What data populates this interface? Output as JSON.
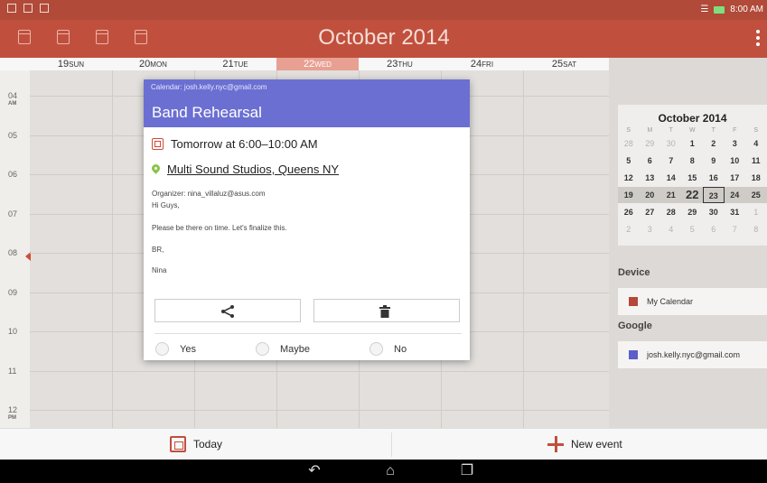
{
  "status_bar": {
    "time": "8:00 AM"
  },
  "app_bar": {
    "title": "October 2014",
    "view_buttons": [
      "day-view-icon",
      "week-view-icon",
      "month-view-icon",
      "agenda-view-icon"
    ]
  },
  "days": [
    {
      "num": "19",
      "name": "SUN"
    },
    {
      "num": "20",
      "name": "MON"
    },
    {
      "num": "21",
      "name": "TUE"
    },
    {
      "num": "22",
      "name": "WED"
    },
    {
      "num": "23",
      "name": "THU"
    },
    {
      "num": "24",
      "name": "FRI"
    },
    {
      "num": "25",
      "name": "SAT"
    }
  ],
  "hours": [
    {
      "h": "04",
      "ampm": "AM"
    },
    {
      "h": "05",
      "ampm": ""
    },
    {
      "h": "06",
      "ampm": ""
    },
    {
      "h": "07",
      "ampm": ""
    },
    {
      "h": "08",
      "ampm": ""
    },
    {
      "h": "09",
      "ampm": ""
    },
    {
      "h": "10",
      "ampm": ""
    },
    {
      "h": "11",
      "ampm": ""
    },
    {
      "h": "12",
      "ampm": "PM"
    }
  ],
  "mini_calendar": {
    "title": "October 2014",
    "weekday_headers": [
      "S",
      "M",
      "T",
      "W",
      "T",
      "F",
      "S"
    ],
    "weeks": [
      [
        "28",
        "29",
        "30",
        "1",
        "2",
        "3",
        "4"
      ],
      [
        "5",
        "6",
        "7",
        "8",
        "9",
        "10",
        "11"
      ],
      [
        "12",
        "13",
        "14",
        "15",
        "16",
        "17",
        "18"
      ],
      [
        "19",
        "20",
        "21",
        "22",
        "23",
        "24",
        "25"
      ],
      [
        "26",
        "27",
        "28",
        "29",
        "30",
        "31",
        "1"
      ],
      [
        "2",
        "3",
        "4",
        "5",
        "6",
        "7",
        "8"
      ]
    ]
  },
  "calendars": {
    "device_label": "Device",
    "device_item": "My Calendar",
    "device_color": "#b5473a",
    "google_label": "Google",
    "google_item": "josh.kelly.nyc@gmail.com",
    "google_color": "#5b5fc7"
  },
  "dialog": {
    "calendar": "Calendar: josh.kelly.nyc@gmail.com",
    "title": "Band Rehearsal",
    "time": "Tomorrow at 6:00–10:00 AM",
    "location": "Multi Sound Studios, Queens NY",
    "organizer": "Organizer: nina_villaluz@asus.com",
    "line1": "Hi Guys,",
    "line2": "Please be there on time. Let's finalize this.",
    "line3": "BR,",
    "line4": "Nina",
    "rsvp": {
      "yes": "Yes",
      "maybe": "Maybe",
      "no": "No"
    },
    "header_color": "#6b6fd2"
  },
  "bottom_bar": {
    "today": "Today",
    "new_event": "New event"
  }
}
